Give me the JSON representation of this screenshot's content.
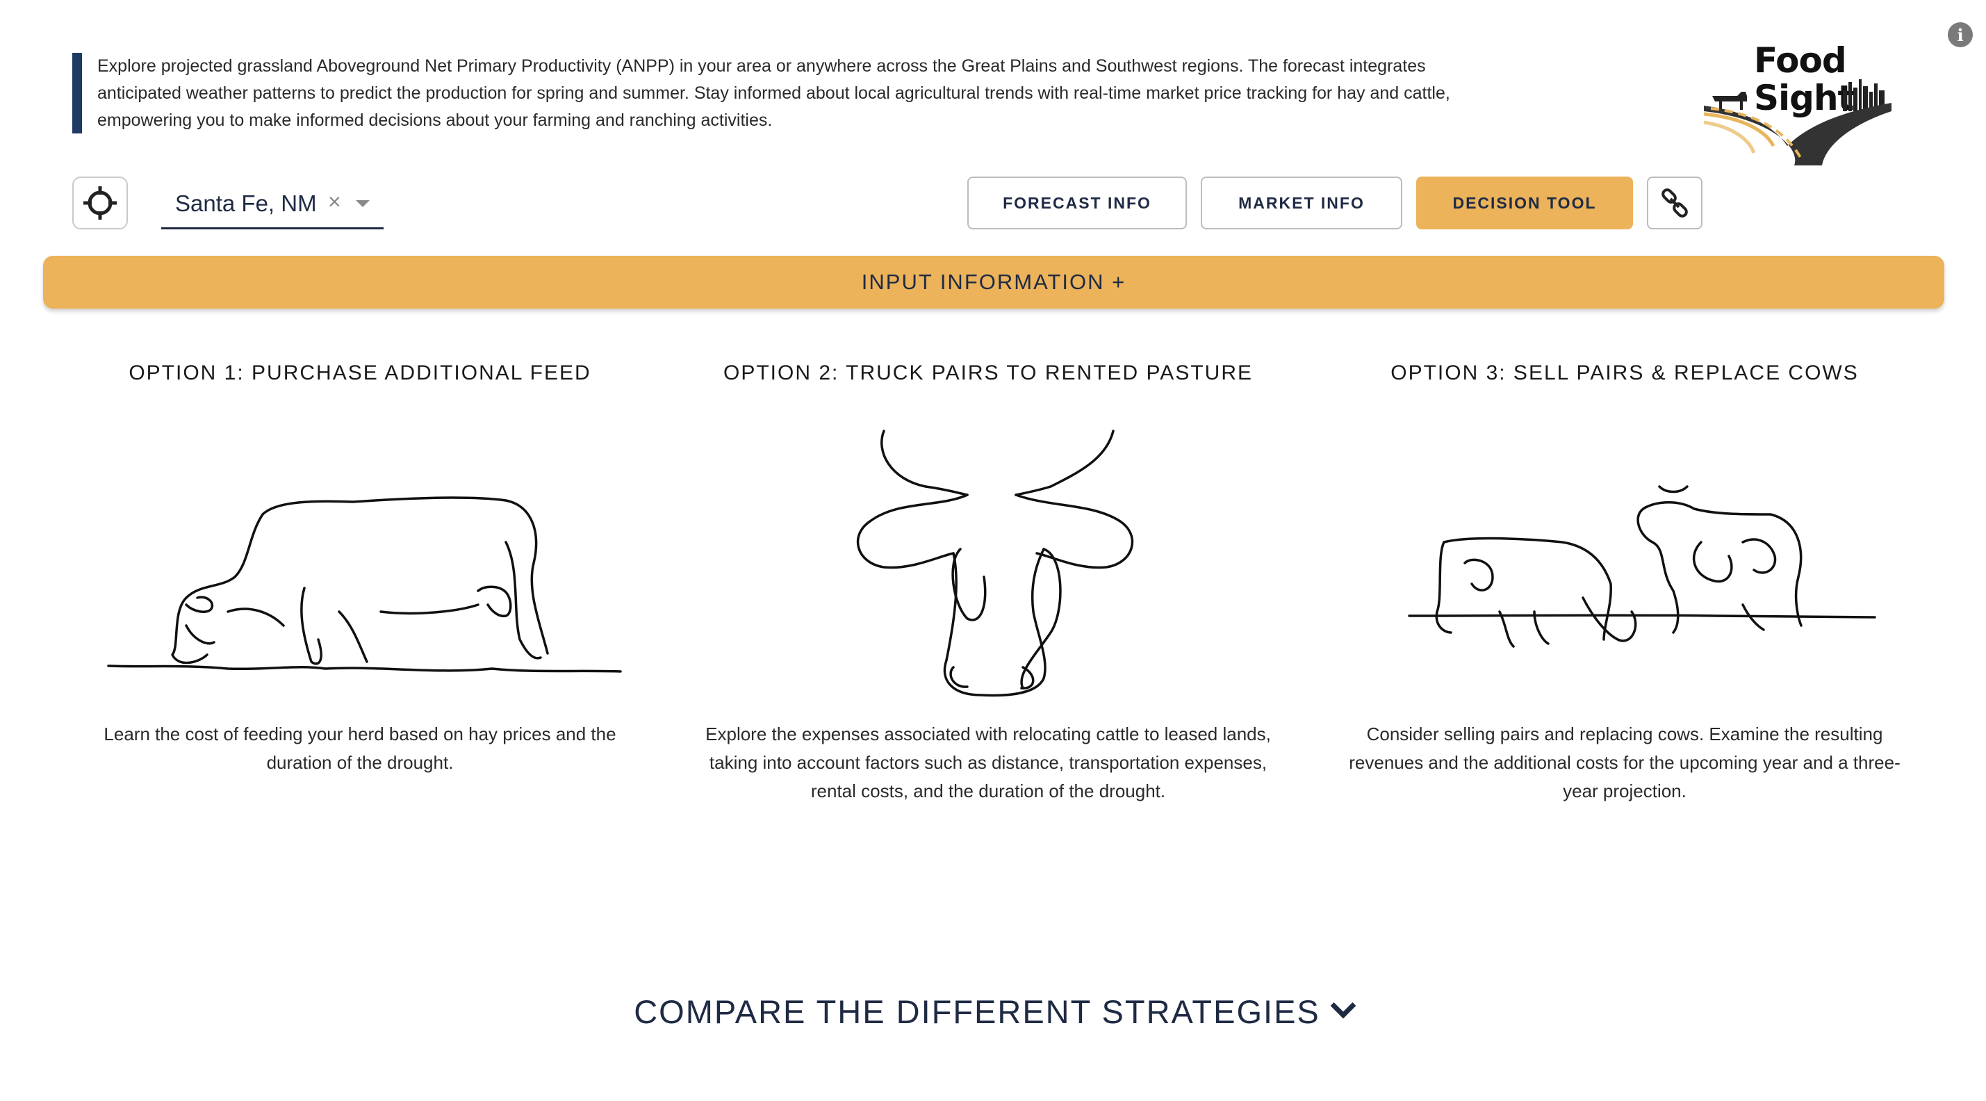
{
  "header": {
    "info_icon": "info-icon",
    "intro_text": "Explore projected grassland Aboveground Net Primary Productivity (ANPP) in your area or anywhere across the Great Plains and Southwest regions. The forecast integrates anticipated weather patterns to predict the production for spring and summer. Stay informed about local agricultural trends with real-time market price tracking for hay and cattle, empowering you to make informed decisions about your farming and ranching activities.",
    "logo_line1": "Food",
    "logo_line2": "Sight"
  },
  "toolbar": {
    "locate_icon": "crosshair-icon",
    "location_value": "Santa Fe, NM",
    "clear_icon": "×",
    "forecast_label": "FORECAST INFO",
    "market_label": "MARKET INFO",
    "decision_label": "DECISION TOOL",
    "active_tab": "DECISION TOOL",
    "link_icon": "link-icon"
  },
  "input_bar": {
    "label": "INPUT INFORMATION +"
  },
  "options": [
    {
      "title": "OPTION 1: PURCHASE ADDITIONAL FEED",
      "description": "Learn the cost of feeding your herd based on hay prices and the duration of the drought."
    },
    {
      "title": "OPTION 2: TRUCK PAIRS TO RENTED PASTURE",
      "description": "Explore the expenses associated with relocating cattle to leased lands, taking into account factors such as distance, transportation expenses, rental costs, and the duration of the drought."
    },
    {
      "title": "OPTION 3: SELL PAIRS & REPLACE COWS",
      "description": "Consider selling pairs and replacing cows. Examine the resulting revenues and the additional costs for the upcoming year and a three-year projection."
    }
  ],
  "compare": {
    "label": "COMPARE THE DIFFERENT STRATEGIES"
  },
  "colors": {
    "accent": "#ecb35a",
    "navy": "#1f2a44",
    "intro_bar": "#1f3a63"
  }
}
